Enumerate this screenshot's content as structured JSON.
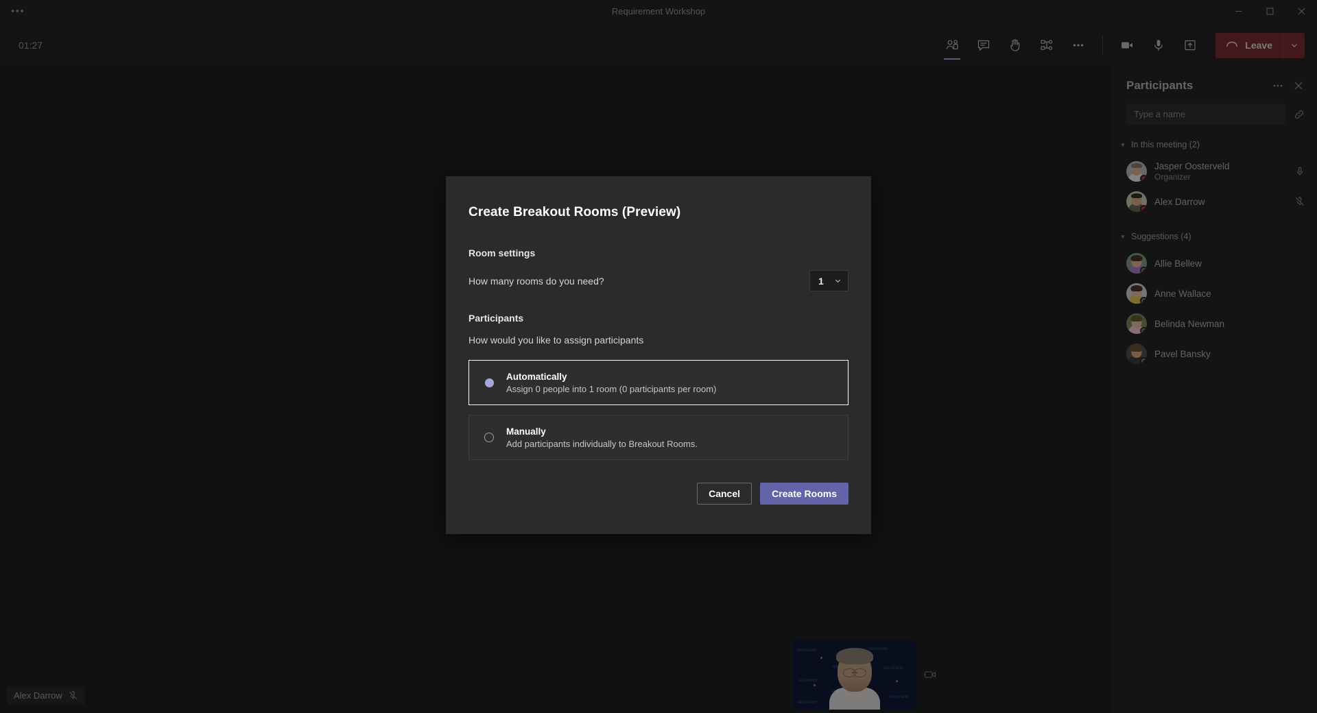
{
  "window": {
    "title": "Requirement Workshop",
    "overflow_icon": "more-horizontal-icon",
    "minimize_icon": "minimize-icon",
    "maximize_icon": "maximize-icon",
    "close_icon": "close-icon"
  },
  "toolbar": {
    "timer": "01:27",
    "actions": [
      {
        "name": "people-icon",
        "label": "People",
        "active": true
      },
      {
        "name": "chat-icon",
        "label": "Chat",
        "active": false
      },
      {
        "name": "raise-hand-icon",
        "label": "Raise hand",
        "active": false
      },
      {
        "name": "breakout-rooms-icon",
        "label": "Breakout rooms",
        "active": false
      },
      {
        "name": "more-options-icon",
        "label": "More actions",
        "active": false
      }
    ],
    "media": [
      {
        "name": "camera-icon",
        "label": "Camera"
      },
      {
        "name": "microphone-icon",
        "label": "Microphone"
      },
      {
        "name": "share-screen-icon",
        "label": "Share content"
      }
    ],
    "leave_label": "Leave",
    "leave_color": "#7b2c36",
    "leave_icon": "hang-up-icon",
    "leave_caret_icon": "chevron-down-icon"
  },
  "stage": {
    "self_name": "Alex Darrow",
    "self_mic_icon": "microphone-muted-icon",
    "selfview_camera_icon": "camera-icon",
    "selfview_bg_words": [
      "ShareGate",
      "ShareGate",
      "ShareGate",
      "ShareGate",
      "ShareGate",
      "ShareGate",
      "ShareGate",
      "ShareGate"
    ]
  },
  "panel": {
    "title": "Participants",
    "more_icon": "more-horizontal-icon",
    "close_icon": "close-icon",
    "search_placeholder": "Type a name",
    "search_value": "",
    "share_link_icon": "link-icon",
    "sections": [
      {
        "label": "In this meeting (2)",
        "caret_icon": "chevron-down-icon",
        "people": [
          {
            "name": "Jasper Oosterveld",
            "role": "Organizer",
            "status": "busy",
            "mic_icon": "microphone-icon",
            "avatar": {
              "skin": "#d9b79a",
              "hair": "#8a7f74",
              "shirt": "#f1f1f1",
              "bg": "#b9bcc4"
            }
          },
          {
            "name": "Alex Darrow",
            "role": "",
            "status": "busy",
            "mic_icon": "microphone-muted-icon",
            "avatar": {
              "skin": "#d9ad86",
              "hair": "#3a2d23",
              "shirt": "#6b6a58",
              "bg": "#c8cfae"
            }
          }
        ]
      },
      {
        "label": "Suggestions (4)",
        "caret_icon": "chevron-down-icon",
        "people": [
          {
            "name": "Allie Bellew",
            "role": "",
            "status": "offline",
            "mic_icon": "",
            "avatar": {
              "skin": "#e3b79a",
              "hair": "#4a3026",
              "shirt": "#b07fc4",
              "bg": "#7f9e86"
            }
          },
          {
            "name": "Anne Wallace",
            "role": "",
            "status": "offline",
            "mic_icon": "",
            "avatar": {
              "skin": "#e8c0a0",
              "hair": "#4b3328",
              "shirt": "#e8c84a",
              "bg": "#cfd3d6"
            }
          },
          {
            "name": "Belinda Newman",
            "role": "",
            "status": "offline",
            "mic_icon": "",
            "avatar": {
              "skin": "#e9c4a6",
              "hair": "#6a5436",
              "shirt": "#f0c9cd",
              "bg": "#7d8a5e"
            }
          },
          {
            "name": "Pavel Bansky",
            "role": "",
            "status": "offline",
            "mic_icon": "",
            "avatar": {
              "skin": "#d9a781",
              "hair": "#6d5034",
              "shirt": "#3c3c40",
              "bg": "#57514a"
            }
          }
        ]
      }
    ]
  },
  "dialog": {
    "title": "Create Breakout Rooms (Preview)",
    "room_settings_label": "Room settings",
    "rooms_question": "How many rooms do you need?",
    "rooms_count": "1",
    "rooms_caret_icon": "chevron-down-icon",
    "participants_label": "Participants",
    "assign_question": "How would you like to assign participants",
    "options": [
      {
        "title": "Automatically",
        "subtitle": "Assign 0 people into 1 room (0 participants per room)",
        "selected": true
      },
      {
        "title": "Manually",
        "subtitle": "Add participants individually to Breakout Rooms.",
        "selected": false
      }
    ],
    "cancel_label": "Cancel",
    "create_label": "Create Rooms",
    "accent_color": "#6264a7",
    "radio_color": "#a6a7dc"
  }
}
